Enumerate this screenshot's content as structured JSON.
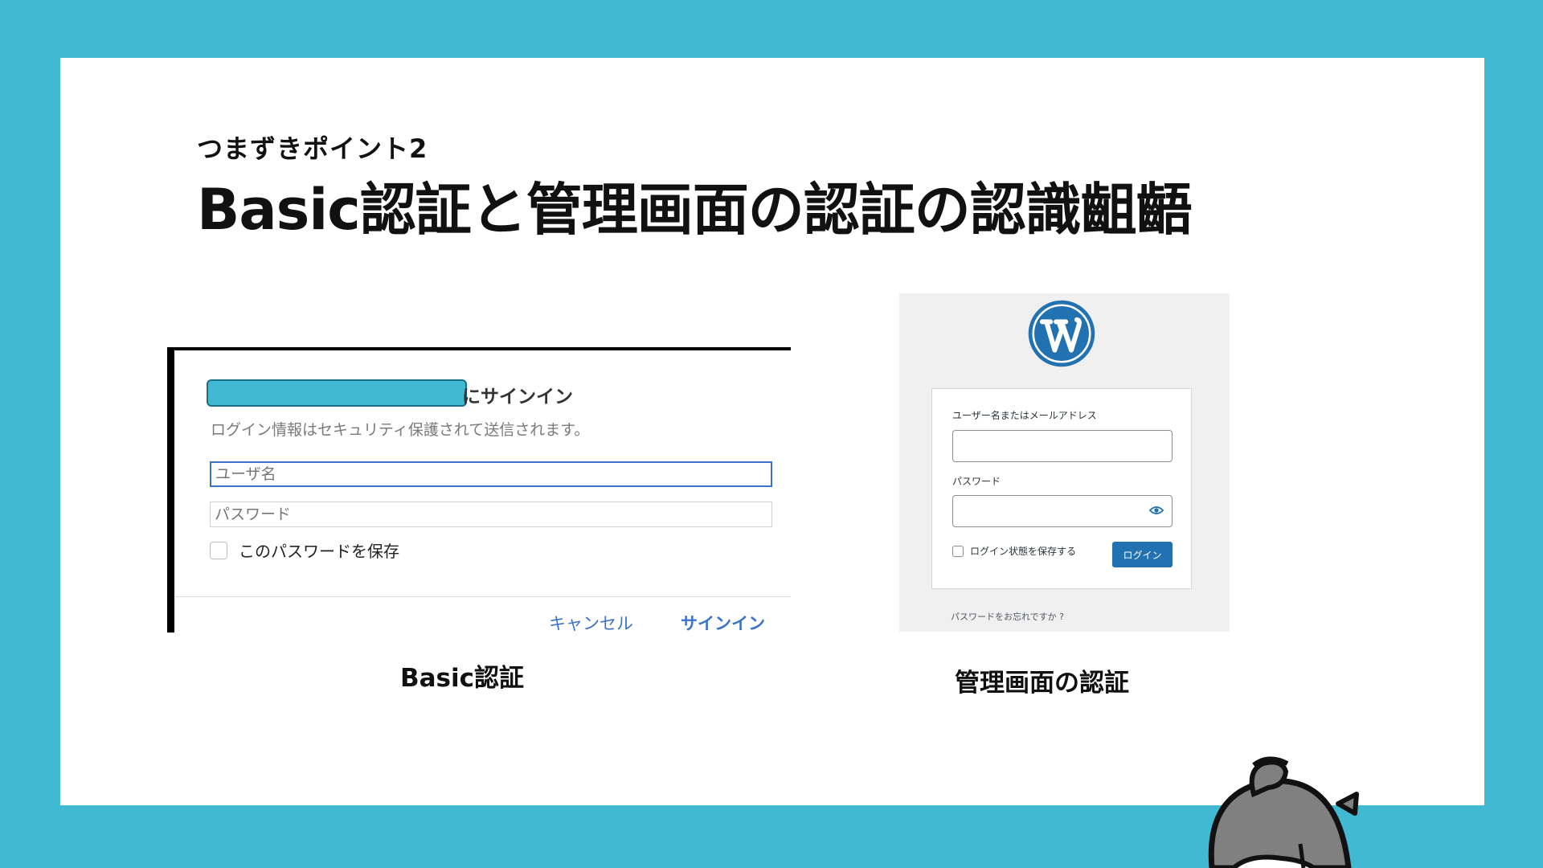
{
  "slide": {
    "subtitle": "つまずきポイント2",
    "title": "Basic認証と管理画面の認証の認識齟齬"
  },
  "basic_auth_dialog": {
    "heading_suffix": "にサインイン",
    "info": "ログイン情報はセキュリティ保護されて送信されます。",
    "username_placeholder": "ユーザ名",
    "password_placeholder": "パスワード",
    "save_password_label": "このパスワードを保存",
    "cancel_label": "キャンセル",
    "signin_label": "サインイン",
    "caption": "Basic認証"
  },
  "wp_login": {
    "username_label": "ユーザー名またはメールアドレス",
    "password_label": "パスワード",
    "remember_label": "ログイン状態を保存する",
    "login_button": "ログイン",
    "lost_password": "パスワードをお忘れですか ?",
    "caption": "管理画面の認証"
  },
  "colors": {
    "background": "#42b9d3",
    "wp_blue": "#2271b1",
    "link_blue": "#3a73c9"
  },
  "icons": {
    "logo": "wordpress-logo-icon",
    "eye": "eye-icon"
  }
}
